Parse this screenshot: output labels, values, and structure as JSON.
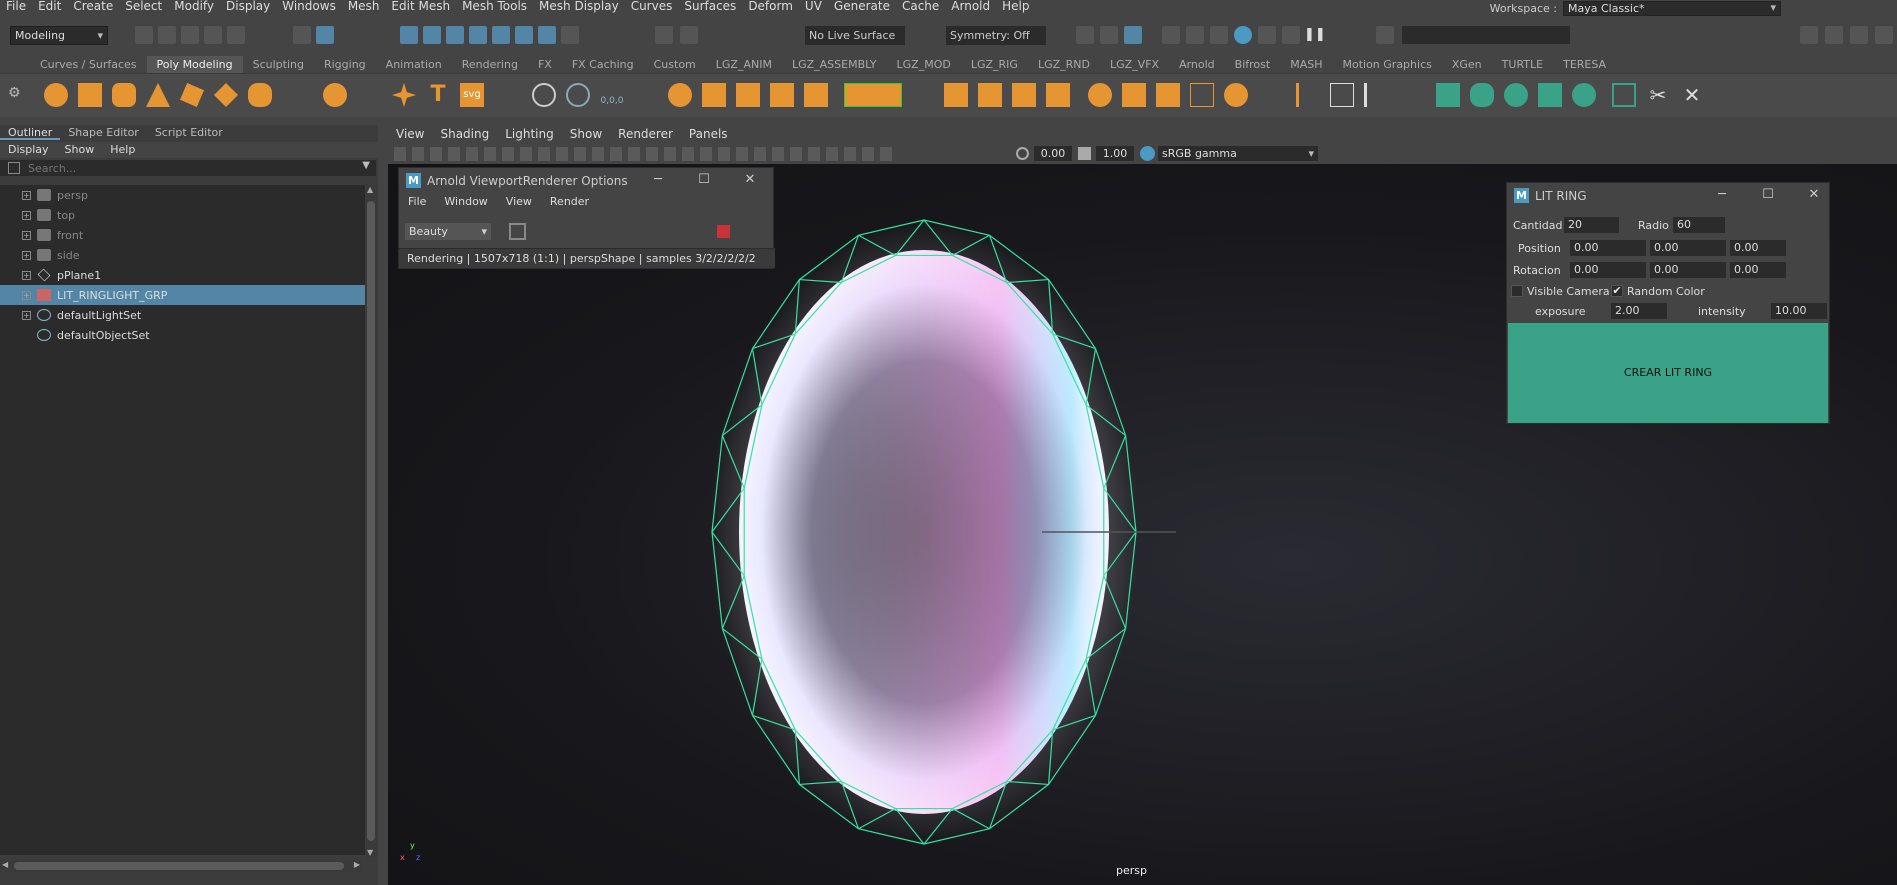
{
  "menubar": {
    "items": [
      "File",
      "Edit",
      "Create",
      "Select",
      "Modify",
      "Display",
      "Windows",
      "Mesh",
      "Edit Mesh",
      "Mesh Tools",
      "Mesh Display",
      "Curves",
      "Surfaces",
      "Deform",
      "UV",
      "Generate",
      "Cache",
      "Arnold",
      "Help"
    ],
    "workspace_label": "Workspace :",
    "workspace_value": "Maya Classic*"
  },
  "statusline": {
    "mode": "Modeling",
    "live_surface": "No Live Surface",
    "symmetry": "Symmetry: Off"
  },
  "shelf": {
    "tabs": [
      "Curves / Surfaces",
      "Poly Modeling",
      "Sculpting",
      "Rigging",
      "Animation",
      "Rendering",
      "FX",
      "FX Caching",
      "Custom",
      "LGZ_ANIM",
      "LGZ_ASSEMBLY",
      "LGZ_MOD",
      "LGZ_RIG",
      "LGZ_RND",
      "LGZ_VFX",
      "Arnold",
      "Bifrost",
      "MASH",
      "Motion Graphics",
      "XGen",
      "TURTLE",
      "TERESA"
    ],
    "active_tab": "Poly Modeling",
    "svg_label": "svg",
    "coord_label": "0,0,0",
    "text_tool": "T"
  },
  "panel_tabs": [
    "Outliner",
    "Shape Editor",
    "Script Editor"
  ],
  "outliner": {
    "menu": [
      "Display",
      "Show",
      "Help"
    ],
    "search_placeholder": "Search...",
    "items": [
      {
        "name": "persp",
        "dim": true
      },
      {
        "name": "top",
        "dim": true
      },
      {
        "name": "front",
        "dim": true
      },
      {
        "name": "side",
        "dim": true
      },
      {
        "name": "pPlane1",
        "dim": false
      },
      {
        "name": "LIT_RINGLIGHT_GRP",
        "dim": false,
        "selected": true
      },
      {
        "name": "defaultLightSet",
        "dim": false
      },
      {
        "name": "defaultObjectSet",
        "dim": false
      }
    ]
  },
  "viewport": {
    "menu": [
      "View",
      "Shading",
      "Lighting",
      "Show",
      "Renderer",
      "Panels"
    ],
    "field_a": "0.00",
    "field_b": "1.00",
    "color_space": "sRGB gamma",
    "camera_label": "persp",
    "axis_y": "y",
    "axis_x": "x",
    "axis_z": "z"
  },
  "arnold_window": {
    "title": "Arnold ViewportRenderer Options",
    "menu": [
      "File",
      "Window",
      "View",
      "Render"
    ],
    "aov": "Beauty",
    "status": "Rendering | 1507x718 (1:1) | perspShape | samples 3/2/2/2/2/2"
  },
  "lit_ring": {
    "title": "LIT RING",
    "cantidad_label": "Cantidad",
    "cantidad": "20",
    "radio_label": "Radio",
    "radio": "60",
    "position_label": "Position",
    "position": [
      "0.00",
      "0.00",
      "0.00"
    ],
    "rotacion_label": "Rotacion",
    "rotacion": [
      "0.00",
      "0.00",
      "0.00"
    ],
    "visible_camera_label": "Visible Camera",
    "random_color_label": "Random Color",
    "random_color_checked": "✔",
    "exposure_label": "exposure",
    "exposure": "2.00",
    "intensity_label": "intensity",
    "intensity": "10.00",
    "button": "CREAR LIT RING"
  },
  "colors": {
    "accent": "#5285a6",
    "shelf_green": "#3aa287",
    "ring_wire": "#38e0a0",
    "stop_red": "#c8323a"
  },
  "window_buttons": {
    "minimize": "─",
    "maximize": "☐",
    "close": "✕"
  }
}
